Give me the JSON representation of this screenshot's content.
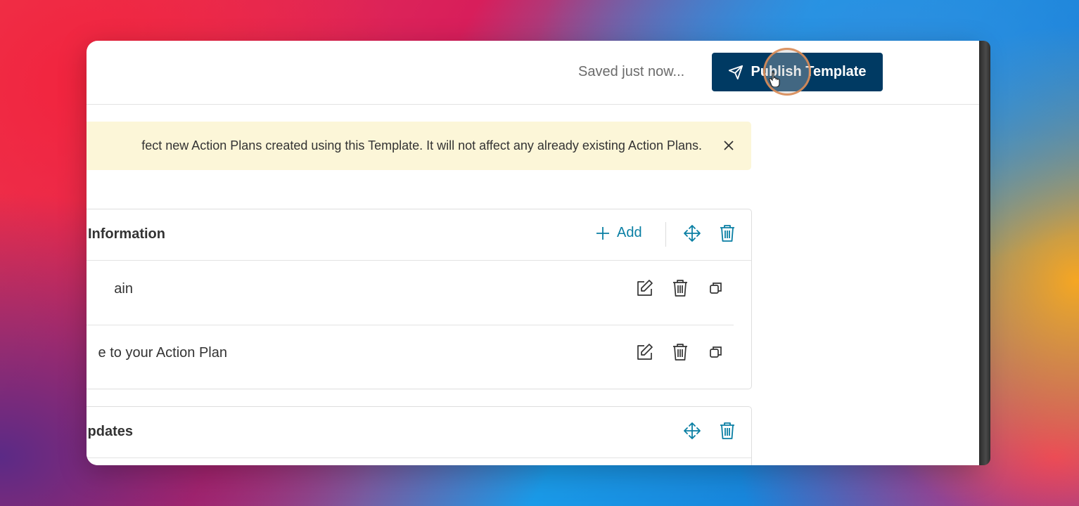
{
  "header": {
    "save_status": "Saved just now...",
    "publish_label": "Publish Template"
  },
  "banner": {
    "text": "fect new Action Plans created using this Template. It will not affect any already existing Action Plans."
  },
  "sections": [
    {
      "title": "Information",
      "add_label": "Add",
      "rows": [
        {
          "label": "ain"
        },
        {
          "label": "e to your Action Plan"
        }
      ]
    },
    {
      "title": "pdates"
    }
  ],
  "colors": {
    "publish_bg": "#003a63",
    "accent_teal": "#0a7fa4",
    "banner_bg": "#fcf6d8"
  },
  "icons": {
    "publish": "send-icon",
    "close": "close-icon",
    "add": "plus-icon",
    "move": "move-icon",
    "delete": "trash-icon",
    "edit": "edit-icon",
    "duplicate": "copy-icon"
  }
}
